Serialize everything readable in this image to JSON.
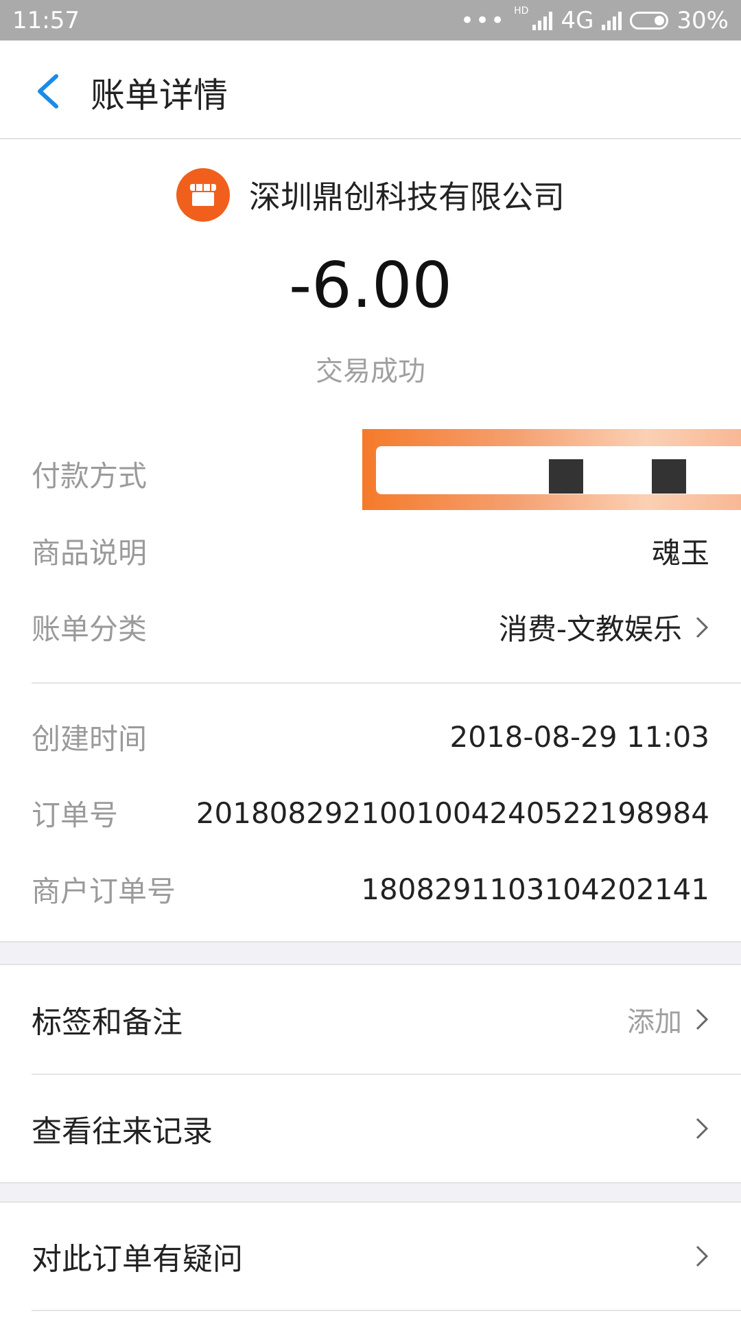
{
  "status_bar": {
    "time": "11:57",
    "hd": "HD",
    "network": "4G",
    "battery": "30%"
  },
  "nav": {
    "title": "账单详情"
  },
  "merchant": {
    "name": "深圳鼎创科技有限公司"
  },
  "transaction": {
    "amount": "-6.00",
    "status": "交易成功"
  },
  "details": {
    "payment_method_label": "付款方式",
    "product_label": "商品说明",
    "product_value": "魂玉",
    "category_label": "账单分类",
    "category_value": "消费-文教娱乐",
    "created_label": "创建时间",
    "created_value": "2018-08-29 11:03",
    "order_no_label": "订单号",
    "order_no_value": "2018082921001004240522198984",
    "merchant_order_label": "商户订单号",
    "merchant_order_value": "1808291103104202141"
  },
  "actions": {
    "tags_label": "标签和备注",
    "tags_action": "添加",
    "history_label": "查看往来记录",
    "question_label": "对此订单有疑问"
  },
  "colors": {
    "accent_blue": "#1a8be8",
    "merchant_orange": "#f0601c"
  }
}
